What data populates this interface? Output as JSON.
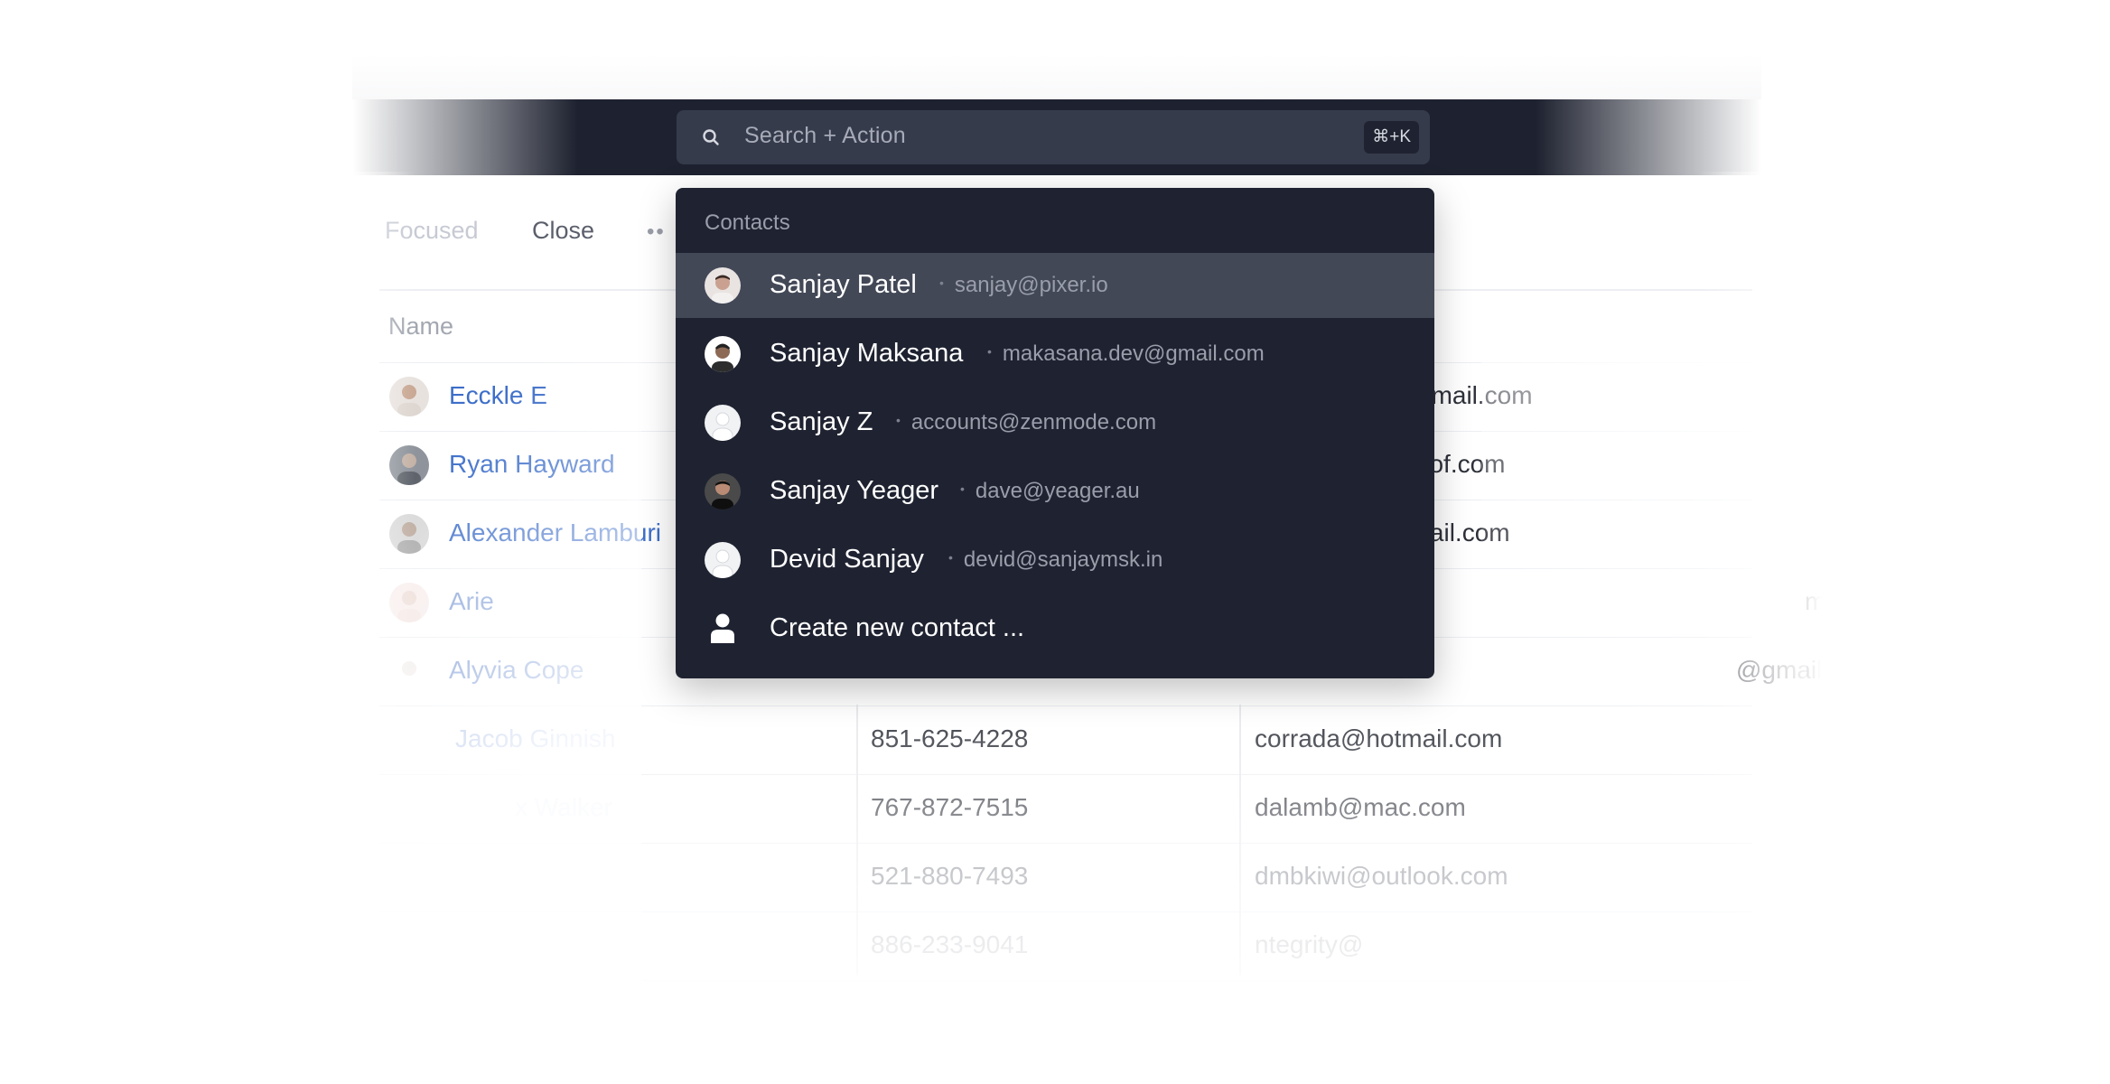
{
  "search": {
    "placeholder": "Search + Action",
    "shortcut": "⌘+K"
  },
  "toolbar": {
    "tabs": [
      {
        "label": "Focused"
      },
      {
        "label": "Close"
      },
      {
        "label": "••"
      }
    ]
  },
  "table": {
    "columns": {
      "name": "Name"
    },
    "rows": [
      {
        "name": "Ecckle E",
        "phone": "",
        "email": "3@gmail.com"
      },
      {
        "name": "Ryan Hayward",
        "phone": "",
        "email": "proof.com"
      },
      {
        "name": "Alexander Lamburi",
        "phone": "",
        "email": "gmail.com"
      },
      {
        "name": "Arie",
        "phone": "",
        "email": "m"
      },
      {
        "name": "Alyvia Cope",
        "phone": "",
        "email": "@gmail.com"
      },
      {
        "name": "Jacob Ginnish",
        "phone": "851-625-4228",
        "email": "corrada@hotmail.com"
      },
      {
        "name": "x Walker",
        "phone": "767-872-7515",
        "email": "dalamb@mac.com"
      },
      {
        "name": "",
        "phone": "521-880-7493",
        "email": "dmbkiwi@outlook.com"
      },
      {
        "name": "",
        "phone": "886-233-9041",
        "email": "ntegrity@"
      }
    ]
  },
  "dropdown": {
    "header": "Contacts",
    "items": [
      {
        "name": "Sanjay Patel",
        "email": "sanjay@pixer.io",
        "active": true
      },
      {
        "name": "Sanjay Maksana",
        "email": "makasana.dev@gmail.com"
      },
      {
        "name": "Sanjay Z",
        "email": "accounts@zenmode.com"
      },
      {
        "name": "Sanjay Yeager",
        "email": "dave@yeager.au"
      },
      {
        "name": "Devid Sanjay",
        "email": "devid@sanjaymsk.in"
      }
    ],
    "create_label": "Create new contact ...",
    "separator": "•"
  },
  "colors": {
    "topbar": "#1e2230",
    "dropdown_bg": "#1f2331",
    "active_item": "#434857",
    "link_blue": "#3d6ec9"
  }
}
